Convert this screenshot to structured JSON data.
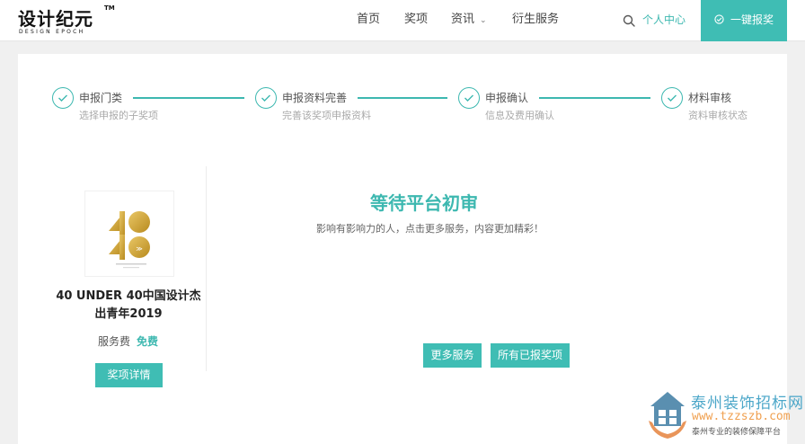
{
  "header": {
    "logo_text": "设计纪元",
    "logo_tm": "TM",
    "logo_sub": "DESIGN EPOCH",
    "nav": [
      {
        "label": "首页"
      },
      {
        "label": "奖项"
      },
      {
        "label": "资讯"
      },
      {
        "label": "衍生服务"
      }
    ],
    "user_center": "个人中心",
    "apply_button": "一键报奖"
  },
  "steps": [
    {
      "title": "申报门类",
      "desc": "选择申报的子奖项"
    },
    {
      "title": "申报资料完善",
      "desc": "完善该奖项申报资料"
    },
    {
      "title": "申报确认",
      "desc": "信息及费用确认"
    },
    {
      "title": "材料审核",
      "desc": "资料审核状态"
    }
  ],
  "product": {
    "title": "40 UNDER 40中国设计杰出青年2019",
    "fee_label": "服务费",
    "fee_value": "免费",
    "detail_button": "奖项详情",
    "poster_text": "40 UNDER 40"
  },
  "status": {
    "title": "等待平台初审",
    "desc": "影响有影响力的人，点击更多服务，内容更加精彩！",
    "more_services_button": "更多服务",
    "all_awards_button": "所有已报奖项"
  },
  "watermark": {
    "name": "泰州装饰招标网",
    "url": "www.tzzszb.com",
    "sub": "泰州专业的装修保障平台"
  },
  "colors": {
    "accent": "#3fbdb4",
    "gold": "#d4a93a"
  }
}
